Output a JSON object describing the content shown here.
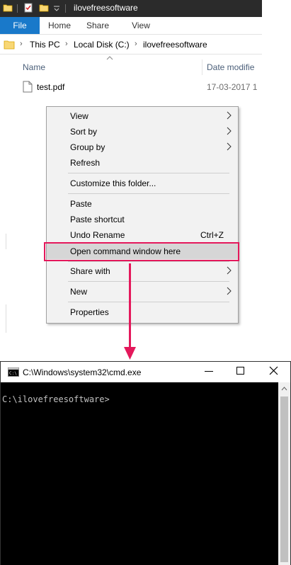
{
  "explorer": {
    "window_title": "ilovefreesoftware",
    "ribbon_tabs": [
      "File",
      "Home",
      "Share",
      "View"
    ],
    "breadcrumb": [
      "This PC",
      "Local Disk (C:)",
      "ilovefreesoftware"
    ],
    "columns": {
      "name": "Name",
      "date": "Date modifie"
    },
    "files": [
      {
        "name": "test.pdf",
        "date": "17-03-2017 1"
      }
    ]
  },
  "context_menu": {
    "items": [
      {
        "label": "View",
        "submenu": true
      },
      {
        "label": "Sort by",
        "submenu": true
      },
      {
        "label": "Group by",
        "submenu": true
      },
      {
        "label": "Refresh"
      },
      {
        "label": "Customize this folder..."
      },
      {
        "label": "Paste"
      },
      {
        "label": "Paste shortcut"
      },
      {
        "label": "Undo Rename",
        "shortcut": "Ctrl+Z"
      },
      {
        "label": "Open command window here",
        "highlighted": true
      },
      {
        "label": "Share with",
        "submenu": true
      },
      {
        "label": "New",
        "submenu": true
      },
      {
        "label": "Properties"
      }
    ]
  },
  "cmd": {
    "title": "C:\\Windows\\system32\\cmd.exe",
    "prompt": "C:\\ilovefreesoftware>"
  },
  "colors": {
    "accent": "#1979ca",
    "highlight_box": "#e4185b",
    "folder": "#f8d775"
  },
  "icons": [
    "folder-icon",
    "checkmark-doc-icon",
    "pdf-file-icon",
    "cmd-app-icon",
    "minimize-icon",
    "maximize-icon",
    "close-icon"
  ]
}
